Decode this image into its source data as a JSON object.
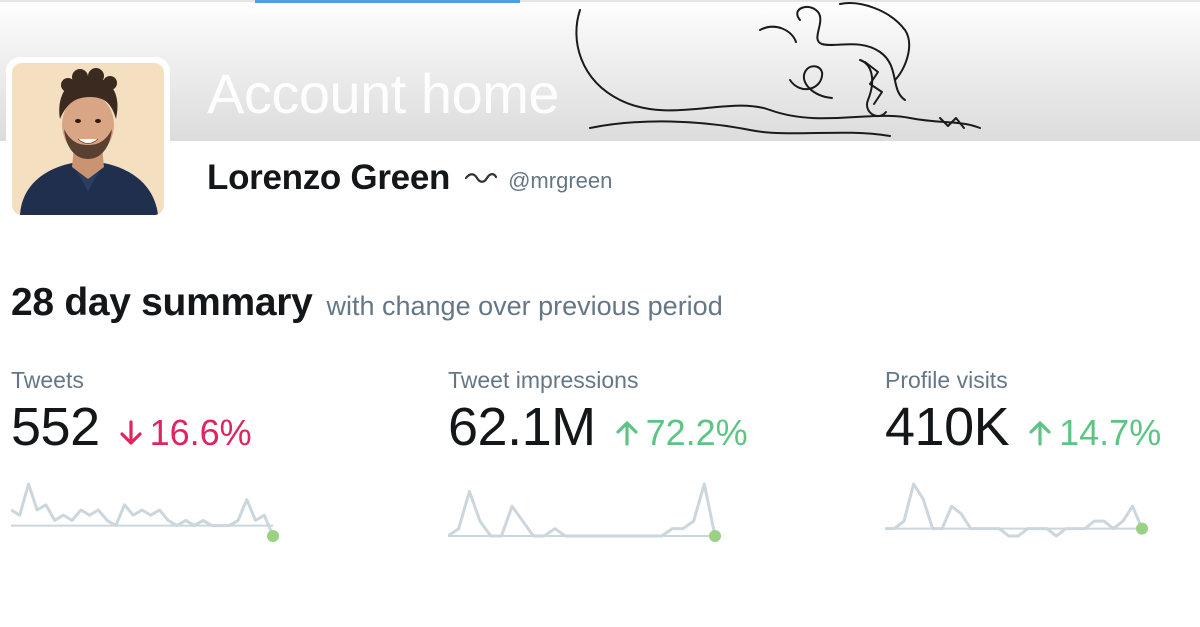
{
  "header": {
    "title": "Account home"
  },
  "profile": {
    "display_name": "Lorenzo Green",
    "handle": "@mrgreen"
  },
  "summary": {
    "title": "28 day summary",
    "subtitle": "with change over previous period"
  },
  "metrics": [
    {
      "label": "Tweets",
      "value": "552",
      "change": "16.6%",
      "direction": "down",
      "trend": [
        3,
        2,
        8,
        3,
        4,
        1,
        2,
        1,
        3,
        2,
        3,
        1,
        0,
        4,
        2,
        3,
        2,
        3,
        1,
        0,
        1,
        0,
        1,
        0,
        0,
        0,
        1,
        5,
        1,
        2,
        -2
      ]
    },
    {
      "label": "Tweet impressions",
      "value": "62.1M",
      "change": "72.2%",
      "direction": "up",
      "trend": [
        0,
        1,
        6,
        2,
        0,
        0,
        4,
        2,
        0,
        0,
        1,
        0,
        0,
        0,
        0,
        0,
        0,
        0,
        0,
        0,
        0,
        1,
        1,
        2,
        7,
        0
      ]
    },
    {
      "label": "Profile visits",
      "value": "410K",
      "change": "14.7%",
      "direction": "up",
      "trend": [
        0,
        0,
        1,
        6,
        4,
        0,
        0,
        3,
        2,
        0,
        0,
        0,
        0,
        -1,
        -1,
        0,
        0,
        0,
        -1,
        0,
        0,
        0,
        1,
        1,
        0,
        1,
        3,
        0
      ]
    }
  ],
  "colors": {
    "text_primary": "#14171a",
    "text_secondary": "#657786",
    "negative": "#e0245e",
    "positive": "#5cc584",
    "sparkline": "#ccd6dd",
    "accent": "#4a9fe5"
  }
}
